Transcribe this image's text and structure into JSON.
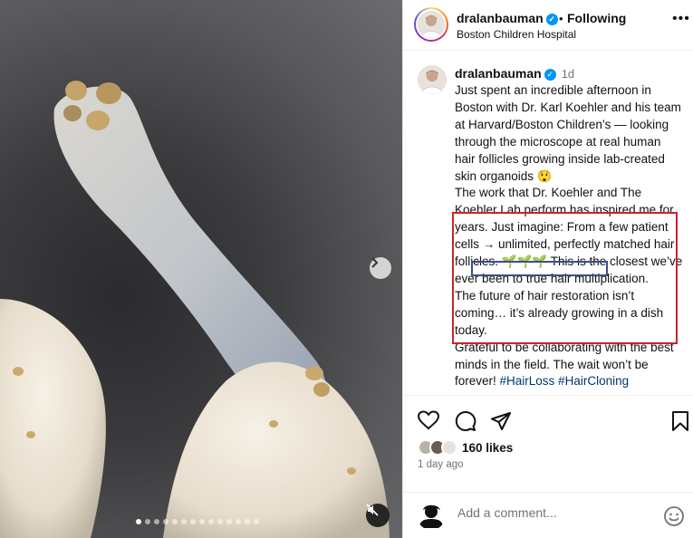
{
  "post_header": {
    "username": "dralanbauman",
    "separator": "•",
    "follow_label": "Following",
    "location": "Boston Children Hospital",
    "more_icon": "more-horizontal-icon"
  },
  "caption": {
    "username": "dralanbauman",
    "time": "1d",
    "text_main": "Just spent an incredible afternoon in Boston with Dr. Karl Koehler and his team at Harvard/Boston Children’s — looking through the microscope at real human hair follicles growing inside lab-created skin organoids 😲\nThe work that Dr. Koehler and The Koehler Lab perform has inspired me for years. Just imagine: From a few patient cells → unlimited, perfectly matched hair follicles. 🌱🌱🌱 This is the closest we’ve ever been to true hair multiplication.\nThe future of hair restoration isn’t coming… it’s already growing in a dish today.\nGrateful to be collaborating with the best minds in the field. The wait won’t be forever! ",
    "hashtags": "#HairLoss #HairCloning"
  },
  "actions": {
    "like_icon": "heart-icon",
    "comment_icon": "comment-icon",
    "share_icon": "share-icon",
    "save_icon": "bookmark-icon",
    "likes": "160 likes",
    "time_ago": "1 day ago"
  },
  "comment_box": {
    "placeholder": "Add a comment...",
    "emoji_icon": "smiley-icon"
  },
  "media": {
    "carousel_count": 14,
    "active_index": 0,
    "next_icon": "chevron-right-icon",
    "mute_icon": "muted-speaker-icon"
  }
}
